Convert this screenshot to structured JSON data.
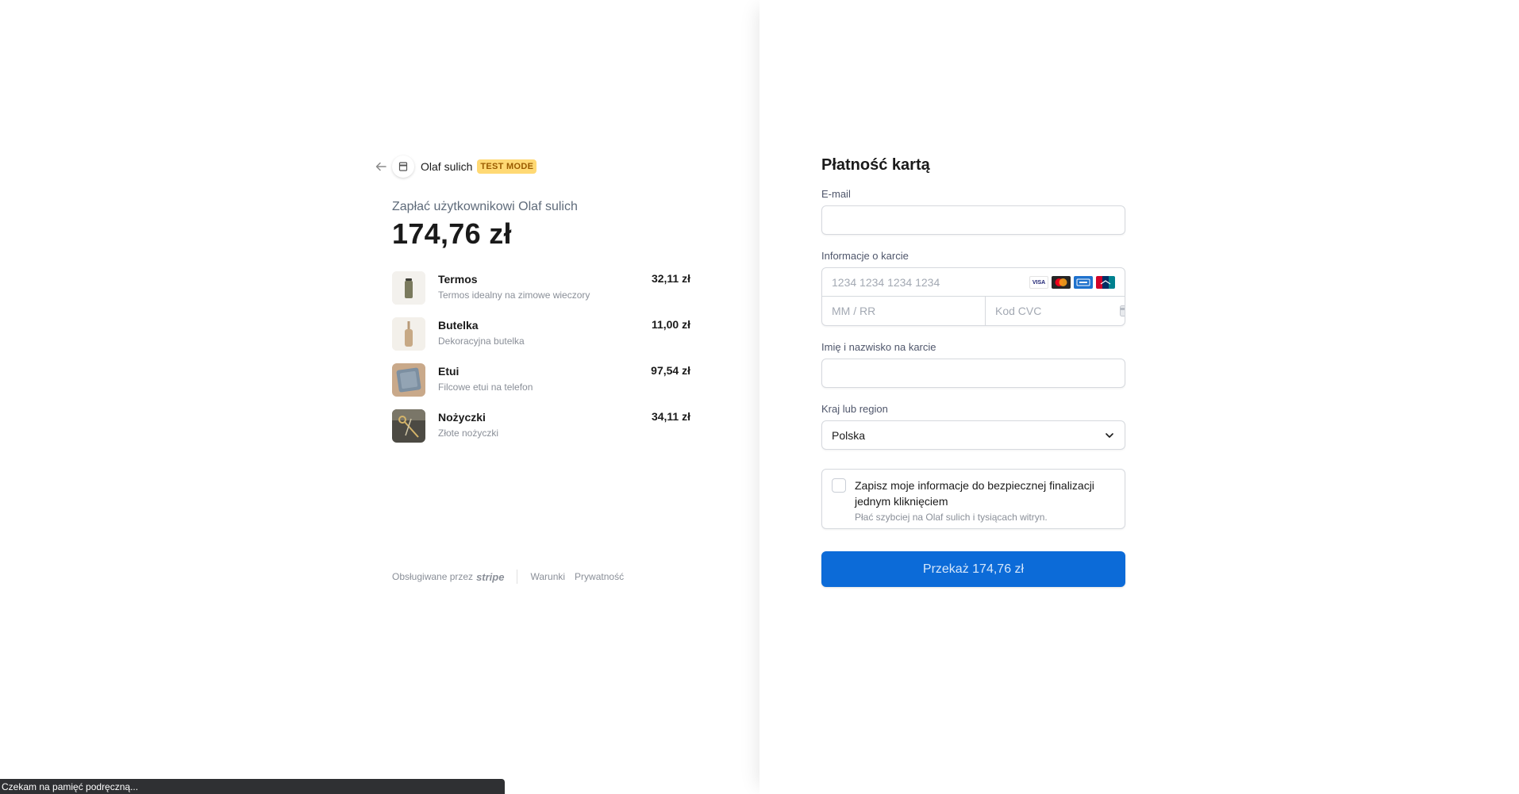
{
  "merchant": {
    "name": "Olaf sulich",
    "test_badge": "TEST MODE"
  },
  "summary": {
    "pay_label": "Zapłać użytkownikowi Olaf sulich",
    "total": "174,76 zł",
    "items": [
      {
        "name": "Termos",
        "desc": "Termos idealny na zimowe wieczory",
        "price": "32,11 zł"
      },
      {
        "name": "Butelka",
        "desc": "Dekoracyjna butelka",
        "price": "11,00 zł"
      },
      {
        "name": "Etui",
        "desc": "Filcowe etui na telefon",
        "price": "97,54 zł"
      },
      {
        "name": "Nożyczki",
        "desc": "Złote nożyczki",
        "price": "34,11 zł"
      }
    ]
  },
  "footer": {
    "powered_by": "Obsługiwane przez",
    "stripe": "stripe",
    "terms": "Warunki",
    "privacy": "Prywatność"
  },
  "status_bar": "Czekam na pamięć podręczną...",
  "form": {
    "title": "Płatność kartą",
    "email_label": "E-mail",
    "email_value": "",
    "card_label": "Informacje o karcie",
    "card_number_placeholder": "1234 1234 1234 1234",
    "expiry_placeholder": "MM / RR",
    "cvc_placeholder": "Kod CVC",
    "brands": [
      "VISA",
      "MC",
      "AMEX",
      "UnionPay"
    ],
    "name_label": "Imię i nazwisko na karcie",
    "name_value": "",
    "country_label": "Kraj lub region",
    "country_value": "Polska",
    "save_title": "Zapisz moje informacje do bezpiecznej finalizacji jednym kliknięciem",
    "save_sub": "Płać szybciej na Olaf sulich i tysiącach witryn.",
    "pay_button": "Przekaż 174,76 zł"
  },
  "colors": {
    "accent": "#0c6bd8",
    "badge_bg": "#ffd974",
    "badge_text": "#9a5b00"
  }
}
